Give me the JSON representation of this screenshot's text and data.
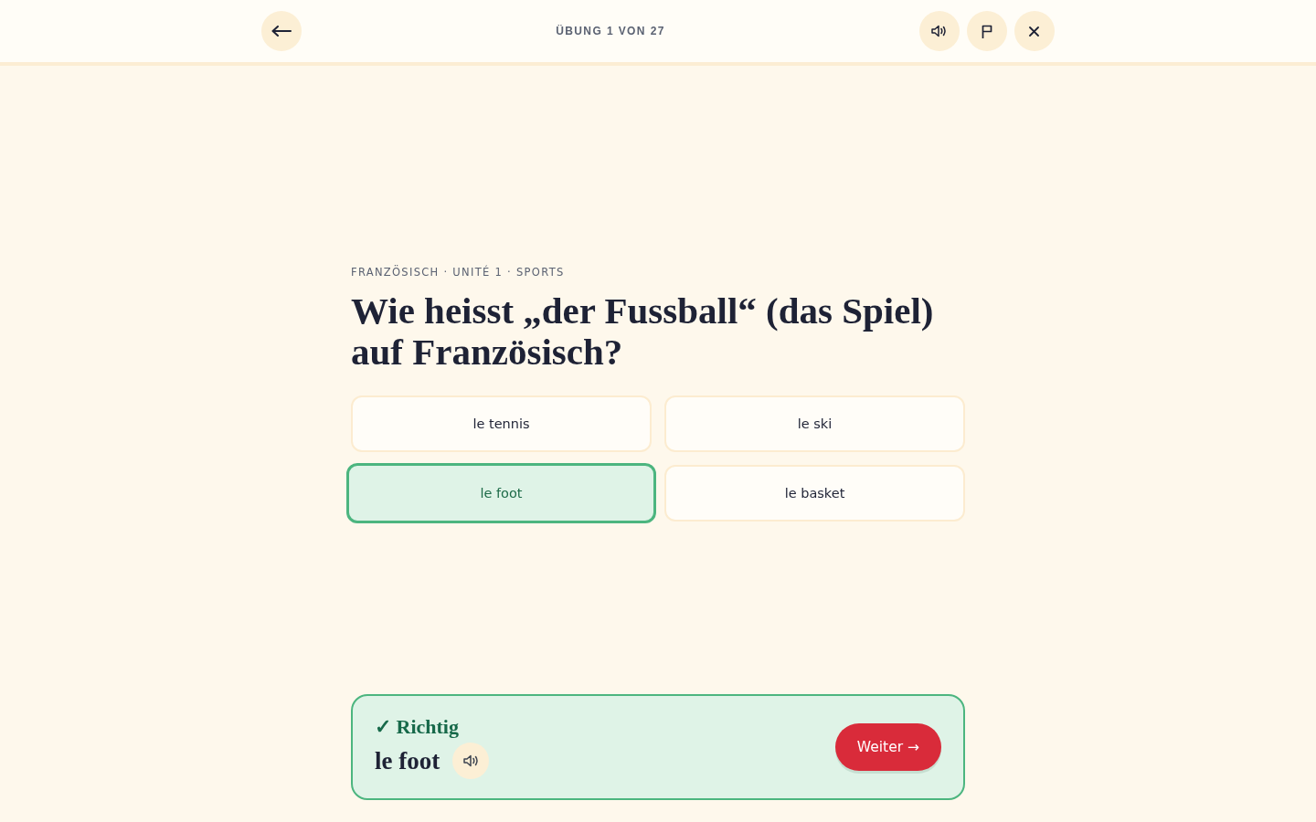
{
  "header": {
    "progress": "ÜBUNG 1 VON 27"
  },
  "question": {
    "eyebrow": "FRANZÖSISCH · UNITÉ 1 · SPORTS",
    "prompt": "Wie heisst „der Fussball“ (das Spiel) auf Französisch?"
  },
  "options": [
    {
      "label": "le tennis",
      "selected": false
    },
    {
      "label": "le ski",
      "selected": false
    },
    {
      "label": "le foot",
      "selected": true
    },
    {
      "label": "le basket",
      "selected": false
    }
  ],
  "feedback": {
    "correct": true,
    "title": "✓ Richtig",
    "answer": "le foot",
    "button": "Weiter →"
  }
}
